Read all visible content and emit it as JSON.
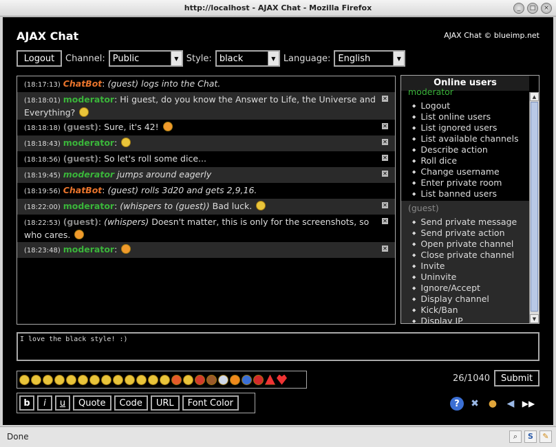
{
  "window": {
    "title": "http://localhost - AJAX Chat - Mozilla Firefox",
    "controls": [
      "minimize",
      "maximize",
      "close"
    ]
  },
  "app": {
    "title": "AJAX Chat",
    "copyright": "AJAX Chat © blueimp.net"
  },
  "toolbar": {
    "logout_label": "Logout",
    "channel_label": "Channel:",
    "channel_value": "Public",
    "style_label": "Style:",
    "style_value": "black",
    "language_label": "Language:",
    "language_value": "English"
  },
  "messages": [
    {
      "time": "(18:17:13)",
      "user": "ChatBot",
      "user_type": "bot",
      "text": "(guest) logs into the Chat.",
      "italic": true,
      "deletable": false,
      "emoticon": ""
    },
    {
      "time": "(18:18:01)",
      "user": "moderator",
      "user_type": "mod",
      "text": "Hi guest, do you know the Answer to Life, the Universe and Everything?",
      "deletable": true,
      "emoticon": "smile"
    },
    {
      "time": "(18:18:18)",
      "user": "(guest)",
      "user_type": "guest",
      "text": "Sure, it's 42!",
      "deletable": true,
      "emoticon": "grin"
    },
    {
      "time": "(18:18:43)",
      "user": "moderator",
      "user_type": "mod",
      "text": "",
      "deletable": true,
      "emoticon": "smile"
    },
    {
      "time": "(18:18:56)",
      "user": "(guest)",
      "user_type": "guest",
      "text": "So let's roll some dice...",
      "deletable": true,
      "emoticon": ""
    },
    {
      "time": "(18:19:45)",
      "user": "moderator",
      "user_type": "mod-action",
      "text": "jumps around eagerly",
      "deletable": true,
      "emoticon": ""
    },
    {
      "time": "(18:19:56)",
      "user": "ChatBot",
      "user_type": "bot",
      "text": "(guest) rolls 3d20 and gets 2,9,16.",
      "deletable": false,
      "emoticon": ""
    },
    {
      "time": "(18:22:00)",
      "user": "moderator",
      "user_type": "mod",
      "whisper": "(whispers to (guest))",
      "text": "Bad luck.",
      "deletable": true,
      "emoticon": "neutral"
    },
    {
      "time": "(18:22:53)",
      "user": "(guest)",
      "user_type": "guest",
      "whisper": "(whispers)",
      "text": "Doesn't matter, this is only for the screenshots, so who cares.",
      "deletable": true,
      "emoticon": "wink"
    },
    {
      "time": "(18:23:48)",
      "user": "moderator",
      "user_type": "mod",
      "text": "",
      "deletable": true,
      "emoticon": "tongue"
    }
  ],
  "online_users": {
    "heading": "Online users",
    "moderator": {
      "name": "moderator",
      "menu": [
        "Logout",
        "List online users",
        "List ignored users",
        "List available channels",
        "Describe action",
        "Roll dice",
        "Change username",
        "Enter private room",
        "List banned users"
      ]
    },
    "guest": {
      "name": "(guest)",
      "menu": [
        "Send private message",
        "Send private action",
        "Open private channel",
        "Close private channel",
        "Invite",
        "Uninvite",
        "Ignore/Accept",
        "Display channel",
        "Kick/Ban",
        "Display IP"
      ]
    }
  },
  "input": {
    "value": "I love the black style! :)"
  },
  "emoticons": [
    "smile",
    "wink",
    "happy",
    "tongue",
    "grin",
    "smug",
    "shocked",
    "neutral",
    "sad",
    "nerd",
    "cool",
    "laugh",
    "cry",
    "angry",
    "grin-big",
    "devil",
    "monkey",
    "question-bubble",
    "exclamation",
    "question",
    "stop",
    "warning",
    "heart"
  ],
  "counter": "26/1040",
  "submit_label": "Submit",
  "format_buttons": {
    "bold": "b",
    "italic": "i",
    "underline": "u",
    "quote": "Quote",
    "code": "Code",
    "url": "URL",
    "font_color": "Font Color"
  },
  "tools": [
    "help-icon",
    "settings-icon",
    "online-users-icon",
    "sound-icon",
    "autoscroll-icon"
  ],
  "statusbar": {
    "text": "Done"
  },
  "colors": {
    "background": "#000000",
    "moderator": "#3ab53a",
    "guest": "#888888",
    "chatbot": "#e8742c",
    "alt_row": "#2a2a2a"
  }
}
